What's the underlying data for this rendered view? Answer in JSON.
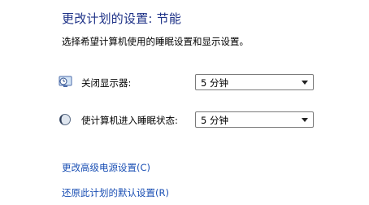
{
  "page": {
    "title": "更改计划的设置: 节能",
    "description": "选择希望计算机使用的睡眠设置和显示设置。"
  },
  "settings": [
    {
      "label": "关闭显示器:",
      "icon": "monitor-clock-icon",
      "value": "5 分钟"
    },
    {
      "label": "使计算机进入睡眠状态:",
      "icon": "moon-sleep-icon",
      "value": "5 分钟"
    }
  ],
  "links": {
    "advanced": "更改高级电源设置(C)",
    "restore": "还原此计划的默认设置(R)"
  },
  "colors": {
    "title": "#1e3287",
    "link": "#1a4fb4"
  }
}
